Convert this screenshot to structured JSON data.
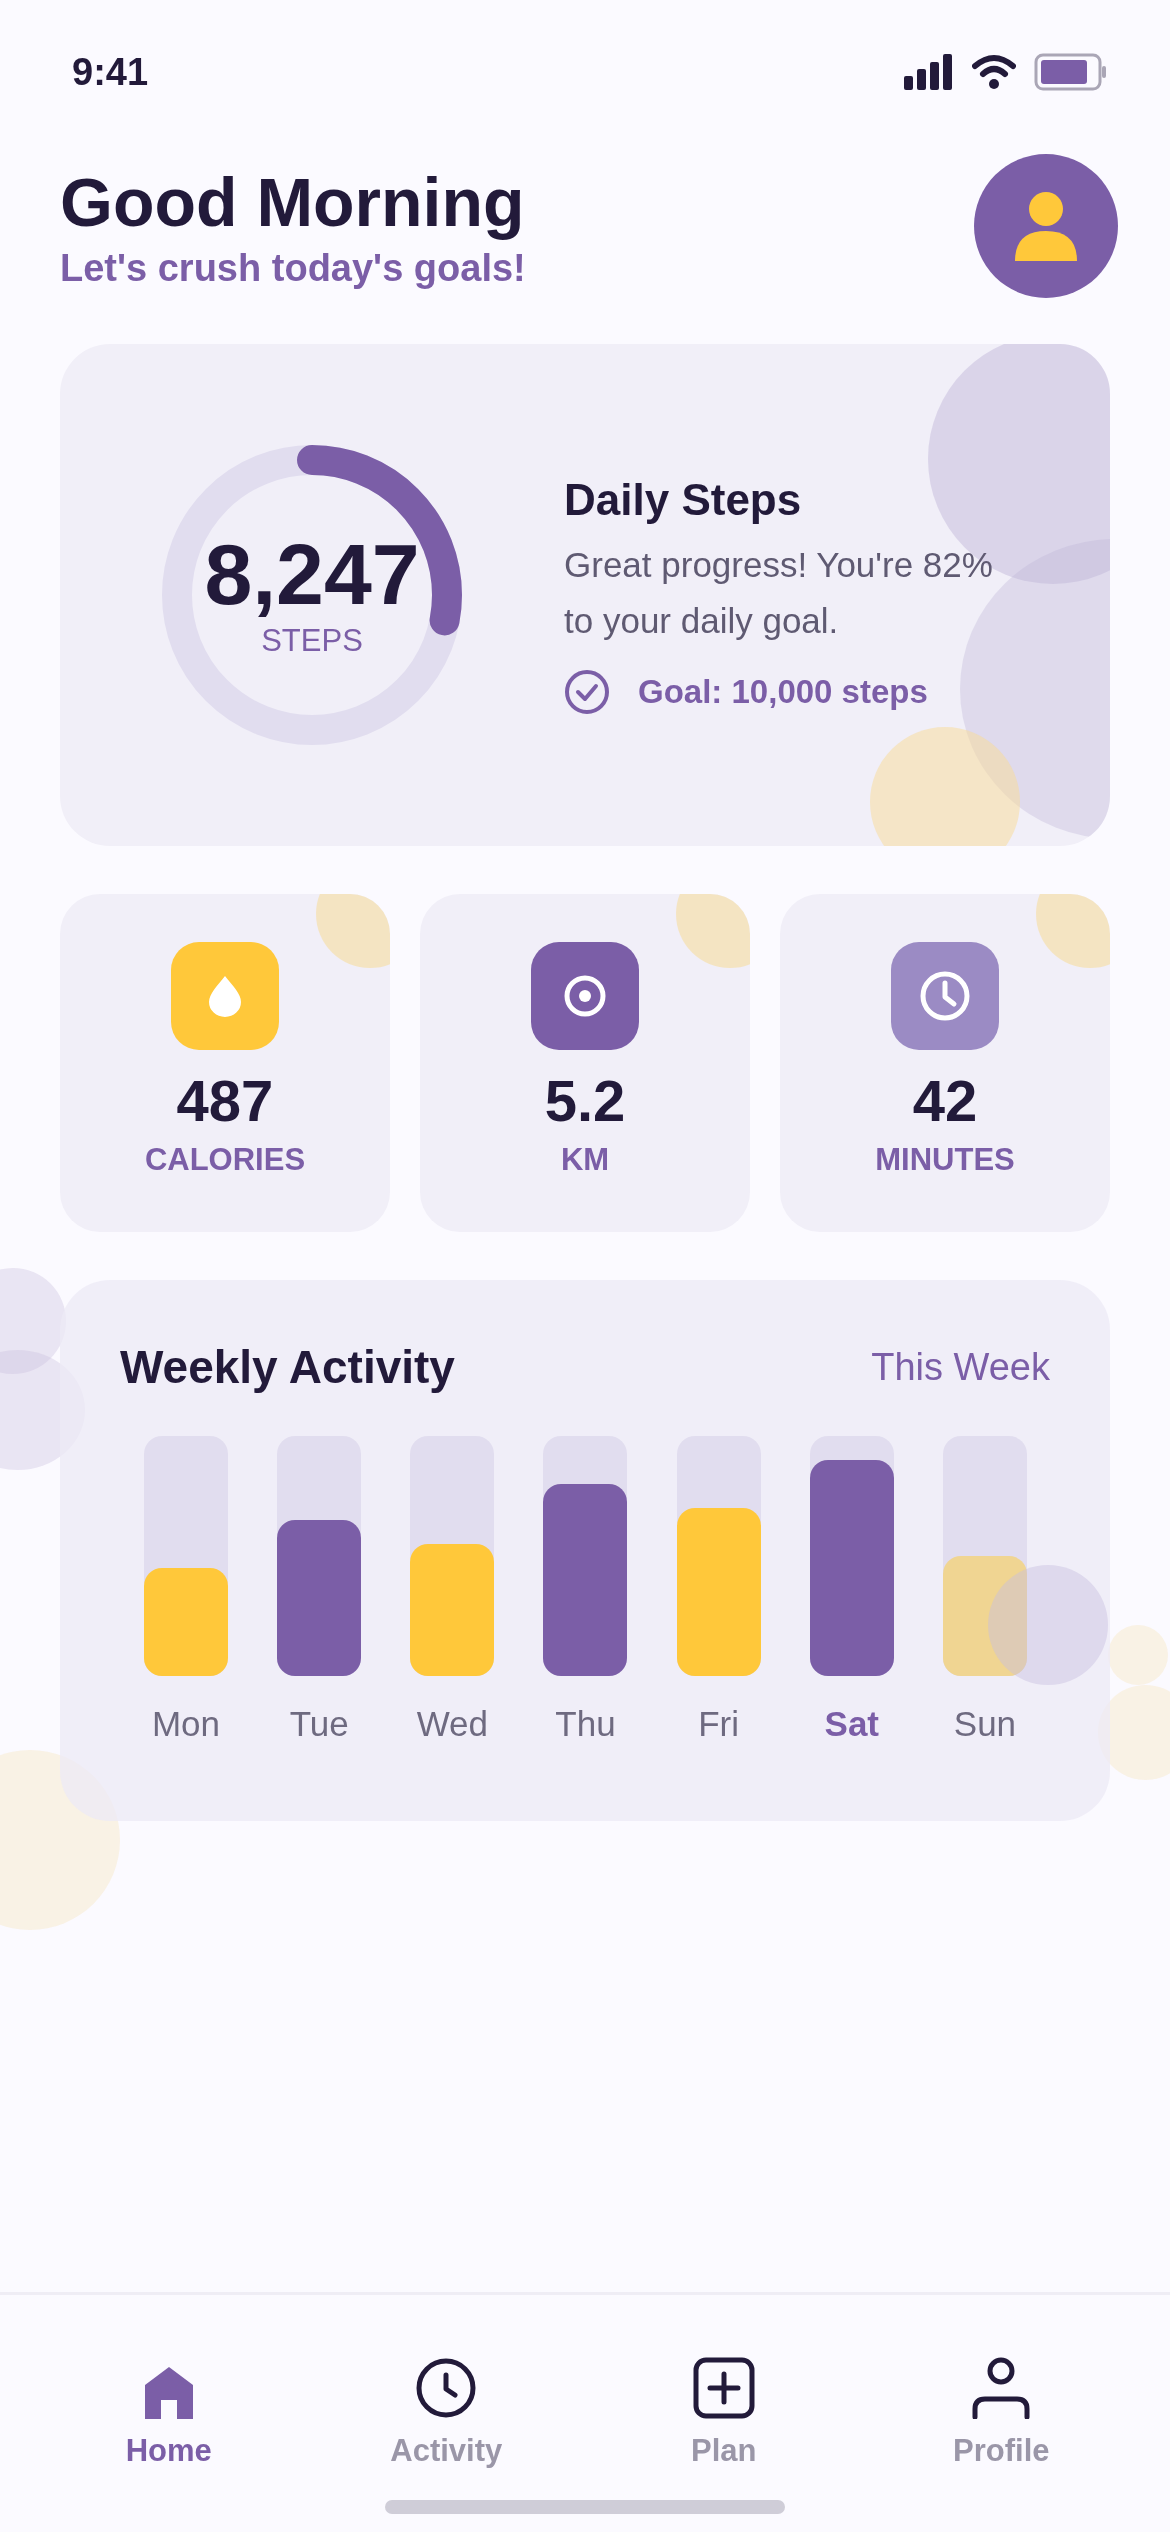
{
  "status_bar": {
    "time": "9:41"
  },
  "header": {
    "title": "Good Morning",
    "subtitle": "Let's crush today's goals!"
  },
  "steps_card": {
    "value": "8,247",
    "unit": "STEPS",
    "level": 0.28,
    "title": "Daily Steps",
    "message": "Great progress! You're 82% to your daily goal.",
    "goal": "Goal: 10,000 steps"
  },
  "stats": [
    {
      "kind": "calories",
      "value": "487",
      "label": "CALORIES",
      "color": "#ffc83a"
    },
    {
      "kind": "distance",
      "value": "5.2",
      "label": "KM",
      "color": "#7b5ea7"
    },
    {
      "kind": "time",
      "value": "42",
      "label": "MINUTES",
      "color": "#9b8bc4"
    }
  ],
  "weekly": {
    "title": "Weekly Activity",
    "period": "This Week",
    "days": [
      {
        "label": "Mon",
        "level": 0.45,
        "color": "#ffc83a",
        "selected": false
      },
      {
        "label": "Tue",
        "level": 0.65,
        "color": "#7b5ea7",
        "selected": false
      },
      {
        "label": "Wed",
        "level": 0.55,
        "color": "#ffc83a",
        "selected": false
      },
      {
        "label": "Thu",
        "level": 0.8,
        "color": "#7b5ea7",
        "selected": false
      },
      {
        "label": "Fri",
        "level": 0.7,
        "color": "#ffc83a",
        "selected": false
      },
      {
        "label": "Sat",
        "level": 0.9,
        "color": "#7b5ea7",
        "selected": true
      },
      {
        "label": "Sun",
        "level": 0.5,
        "color": "#f0d592",
        "selected": false
      }
    ]
  },
  "nav": [
    {
      "kind": "home",
      "label": "Home",
      "selected": true
    },
    {
      "kind": "activity",
      "label": "Activity",
      "selected": false
    },
    {
      "kind": "plan",
      "label": "Plan",
      "selected": false
    },
    {
      "kind": "profile",
      "label": "Profile",
      "selected": false
    }
  ]
}
